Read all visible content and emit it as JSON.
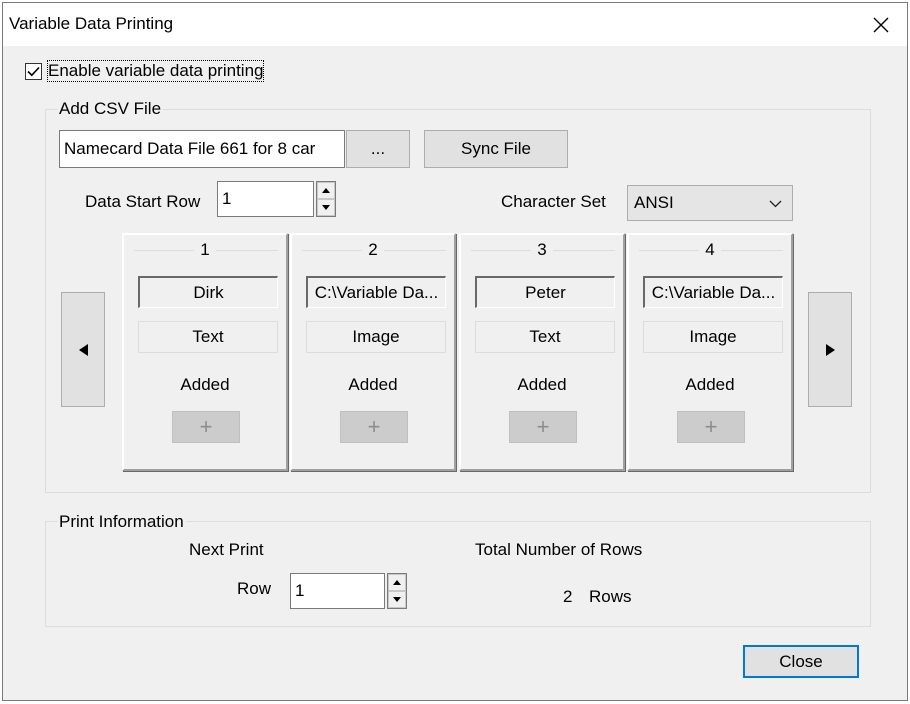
{
  "window": {
    "title": "Variable Data Printing"
  },
  "enable": {
    "label": "Enable variable data printing",
    "checked": true
  },
  "csv": {
    "group_label": "Add CSV File",
    "file_value": "Namecard Data File 661 for 8 car",
    "browse_label": "...",
    "sync_label": "Sync File",
    "start_row_label": "Data Start Row",
    "start_row_value": "1",
    "charset_label": "Character Set",
    "charset_value": "ANSI"
  },
  "columns": [
    {
      "num": "1",
      "value": "Dirk",
      "type": "Text",
      "status": "Added",
      "add": "+"
    },
    {
      "num": "2",
      "value": "C:\\Variable Da...",
      "type": "Image",
      "status": "Added",
      "add": "+"
    },
    {
      "num": "3",
      "value": "Peter",
      "type": "Text",
      "status": "Added",
      "add": "+"
    },
    {
      "num": "4",
      "value": "C:\\Variable Da...",
      "type": "Image",
      "status": "Added",
      "add": "+"
    }
  ],
  "print": {
    "group_label": "Print Information",
    "next_print_label": "Next Print",
    "row_label": "Row",
    "row_value": "1",
    "total_label": "Total Number of Rows",
    "total_count": "2",
    "rows_unit": "Rows"
  },
  "footer": {
    "close_label": "Close"
  },
  "icons": {
    "close": "close-x-icon",
    "check": "checkmark-icon",
    "prev": "triangle-left-icon",
    "next": "triangle-right-icon",
    "dropdown": "chevron-down-icon",
    "spin_up": "spin-up-icon",
    "spin_down": "spin-down-icon"
  }
}
